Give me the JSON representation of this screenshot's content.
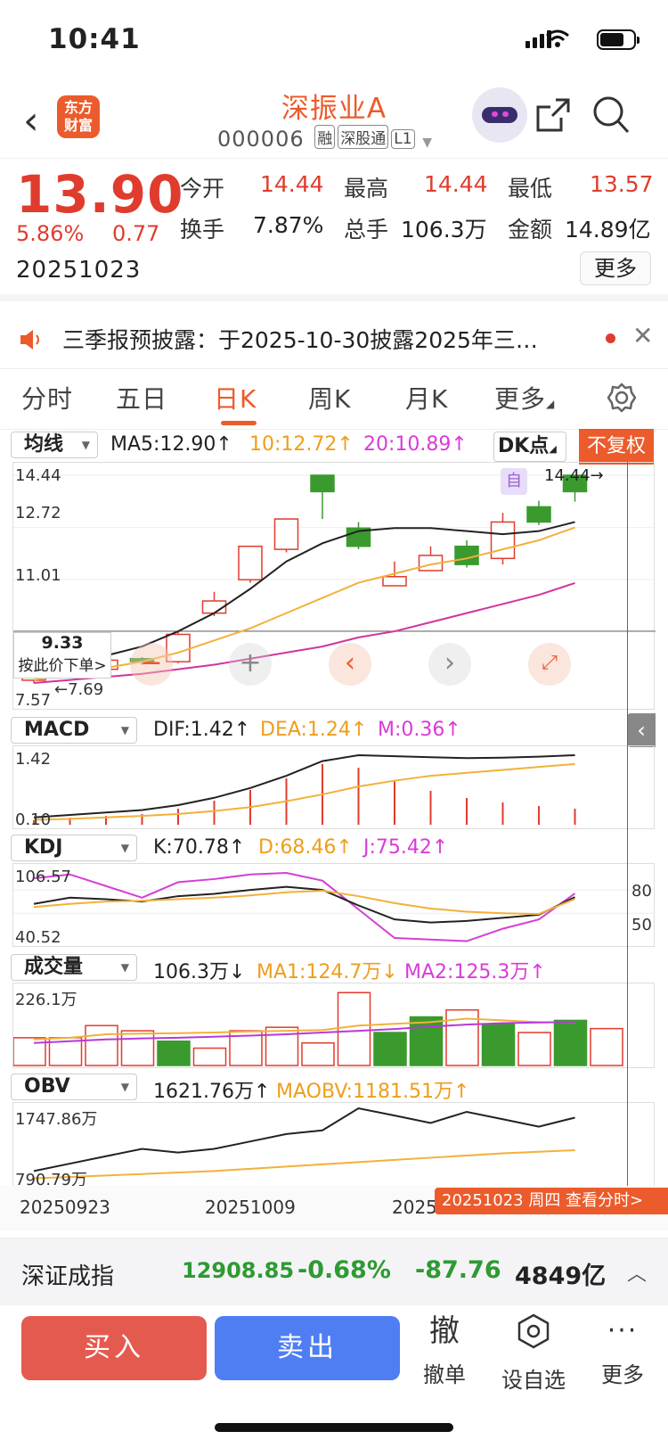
{
  "status": {
    "time": "10:41"
  },
  "header": {
    "logo_line1": "东方",
    "logo_line2": "财富",
    "name": "深振业A",
    "code": "000006",
    "tags": [
      "融",
      "深股通",
      "L1"
    ]
  },
  "quote": {
    "price": "13.90",
    "change_pct": "5.86%",
    "change_amt": "0.77",
    "date": "20251023",
    "open_label": "今开",
    "open": "14.44",
    "high_label": "最高",
    "high": "14.44",
    "low_label": "最低",
    "low": "13.57",
    "turnover_label": "换手",
    "turnover": "7.87%",
    "volume_label": "总手",
    "volume": "106.3万",
    "amount_label": "金额",
    "amount": "14.89亿",
    "more": "更多"
  },
  "notice": {
    "text": "三季报预披露：于2025-10-30披露2025年三…"
  },
  "tabs": [
    "分时",
    "五日",
    "日K",
    "周K",
    "月K",
    "更多"
  ],
  "main_ind": {
    "select": "均线",
    "ma5": "MA5:12.90↑",
    "ma10": "10:12.72↑",
    "ma20": "20:10.89↑",
    "dk": "DK点",
    "fq": "不复权"
  },
  "main_chart": {
    "y_top": "14.44",
    "y_2": "12.72",
    "y_3": "11.01",
    "y_4": "9.33",
    "y_bottom": "7.57",
    "cross_price": "9.33",
    "cross_tip": "按此价下单>",
    "low_mark": "7.69",
    "high_mark": "14.44→",
    "self_mark": "自"
  },
  "macd": {
    "select": "MACD",
    "dif": "DIF:1.42↑",
    "dea": "DEA:1.24↑",
    "m": "M:0.36↑",
    "y_top": "1.42",
    "y_bottom": "0.10"
  },
  "kdj": {
    "select": "KDJ",
    "k": "K:70.78↑",
    "d": "D:68.46↑",
    "j": "J:75.42↑",
    "y_top": "106.57",
    "y_bottom": "40.52",
    "r80": "80",
    "r50": "50"
  },
  "vol": {
    "select": "成交量",
    "v": "106.3万↓",
    "ma1": "MA1:124.7万↓",
    "ma2": "MA2:125.3万↑",
    "y_top": "226.1万"
  },
  "obv": {
    "select": "OBV",
    "v": "1621.76万↑",
    "ma": "MAOBV:1181.51万↑",
    "y_top": "1747.86万",
    "y_bottom": "790.79万"
  },
  "xaxis": {
    "d1": "20250923",
    "d2": "20251009",
    "d3": "2025",
    "tip": "20251023 周四 查看分时>"
  },
  "index": {
    "name": "深证成指",
    "value": "12908.85",
    "pct": "-0.68%",
    "chg": "-87.76",
    "amount": "4849亿"
  },
  "bottom": {
    "buy": "买入",
    "sell": "卖出",
    "cancel_glyph": "撤",
    "cancel": "撤单",
    "watch": "设自选",
    "more": "更多"
  },
  "chart_data": {
    "type": "candlestick",
    "candles": [
      {
        "o": 7.69,
        "c": 8.1,
        "h": 8.2,
        "l": 7.6
      },
      {
        "o": 8.1,
        "c": 8.0,
        "h": 8.3,
        "l": 7.95
      },
      {
        "o": 8.05,
        "c": 8.35,
        "h": 8.9,
        "l": 8.0
      },
      {
        "o": 8.4,
        "c": 8.3,
        "h": 8.45,
        "l": 8.2
      },
      {
        "o": 8.3,
        "c": 9.2,
        "h": 9.3,
        "l": 8.25
      },
      {
        "o": 9.9,
        "c": 10.3,
        "h": 10.6,
        "l": 9.8
      },
      {
        "o": 11.0,
        "c": 12.1,
        "h": 12.1,
        "l": 10.9
      },
      {
        "o": 12.0,
        "c": 13.0,
        "h": 13.0,
        "l": 11.9
      },
      {
        "o": 14.44,
        "c": 13.9,
        "h": 14.44,
        "l": 13.0
      },
      {
        "o": 12.7,
        "c": 12.1,
        "h": 12.9,
        "l": 12.0
      },
      {
        "o": 10.8,
        "c": 11.1,
        "h": 11.6,
        "l": 10.8
      },
      {
        "o": 11.3,
        "c": 11.8,
        "h": 12.1,
        "l": 11.3
      },
      {
        "o": 12.1,
        "c": 11.5,
        "h": 12.3,
        "l": 11.4
      },
      {
        "o": 11.7,
        "c": 12.9,
        "h": 13.2,
        "l": 11.5
      },
      {
        "o": 13.4,
        "c": 12.9,
        "h": 13.6,
        "l": 12.8
      },
      {
        "o": 14.44,
        "c": 13.9,
        "h": 14.44,
        "l": 13.57
      }
    ],
    "ma5": [
      8.0,
      8.2,
      8.5,
      8.8,
      9.3,
      9.9,
      10.7,
      11.6,
      12.2,
      12.6,
      12.7,
      12.7,
      12.6,
      12.5,
      12.6,
      12.9
    ],
    "ma10": [
      7.7,
      7.9,
      8.1,
      8.3,
      8.6,
      9.0,
      9.4,
      9.9,
      10.4,
      10.9,
      11.2,
      11.5,
      11.7,
      12.0,
      12.3,
      12.72
    ],
    "ma20": [
      7.6,
      7.7,
      7.8,
      7.9,
      8.05,
      8.2,
      8.4,
      8.6,
      8.8,
      9.1,
      9.3,
      9.6,
      9.9,
      10.2,
      10.5,
      10.89
    ],
    "macd_dif": [
      0.15,
      0.2,
      0.25,
      0.3,
      0.4,
      0.55,
      0.75,
      1.0,
      1.3,
      1.42,
      1.4,
      1.38,
      1.36,
      1.37,
      1.39,
      1.42
    ],
    "macd_dea": [
      0.1,
      0.12,
      0.15,
      0.18,
      0.22,
      0.28,
      0.36,
      0.48,
      0.62,
      0.78,
      0.9,
      1.0,
      1.06,
      1.12,
      1.18,
      1.24
    ],
    "macd_m": [
      0.05,
      0.08,
      0.1,
      0.12,
      0.18,
      0.27,
      0.39,
      0.52,
      0.68,
      0.64,
      0.5,
      0.38,
      0.3,
      0.25,
      0.21,
      0.18
    ],
    "k": [
      62,
      70,
      68,
      65,
      72,
      75,
      80,
      84,
      80,
      60,
      42,
      38,
      40,
      44,
      48,
      70.78
    ],
    "d": [
      58,
      62,
      65,
      66,
      68,
      70,
      73,
      77,
      79,
      72,
      63,
      56,
      52,
      50,
      49,
      68.46
    ],
    "j": [
      95,
      100,
      85,
      70,
      90,
      94,
      100,
      102,
      92,
      55,
      18,
      16,
      14,
      30,
      42,
      75.42
    ],
    "vol": [
      80,
      80,
      115,
      100,
      70,
      50,
      100,
      110,
      65,
      210,
      95,
      140,
      160,
      120,
      95,
      130,
      106.3
    ],
    "vol_up": [
      true,
      true,
      true,
      true,
      false,
      true,
      true,
      true,
      true,
      true,
      false,
      false,
      true,
      false,
      true,
      false,
      true
    ],
    "vol_ma1": [
      75,
      80,
      90,
      92,
      93,
      95,
      98,
      100,
      102,
      115,
      120,
      125,
      135,
      130,
      125,
      124.7
    ],
    "vol_ma2": [
      65,
      70,
      75,
      78,
      80,
      83,
      86,
      90,
      95,
      100,
      105,
      112,
      118,
      122,
      124,
      125.3
    ],
    "obv": [
      900,
      1000,
      1100,
      1200,
      1150,
      1200,
      1300,
      1400,
      1450,
      1747,
      1650,
      1550,
      1700,
      1600,
      1500,
      1621.76
    ],
    "maobv": [
      800,
      820,
      840,
      860,
      880,
      900,
      930,
      960,
      990,
      1020,
      1050,
      1080,
      1110,
      1140,
      1160,
      1181.51
    ]
  }
}
